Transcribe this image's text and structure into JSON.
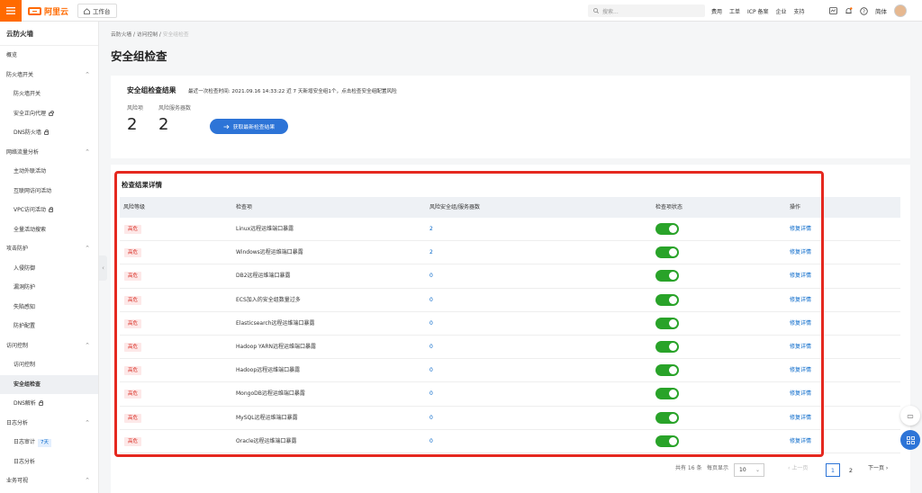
{
  "topbar": {
    "logo_text": "阿里云",
    "workbench": "工作台",
    "search_placeholder": "搜索...",
    "links": [
      "费用",
      "工单",
      "ICP 备案",
      "企业",
      "支持"
    ],
    "lang": "简体"
  },
  "sidebar": {
    "title": "云防火墙",
    "rows": [
      {
        "label": "概览",
        "kind": "group"
      },
      {
        "label": "防火墙开关",
        "kind": "group",
        "chevron": true
      },
      {
        "label": "防火墙开关",
        "kind": "item"
      },
      {
        "label": "安全正向代理",
        "kind": "item",
        "lock": true
      },
      {
        "label": "DNS防火墙",
        "kind": "item",
        "lock": true
      },
      {
        "label": "网络流量分析",
        "kind": "group",
        "chevron": true
      },
      {
        "label": "主动外联活动",
        "kind": "item"
      },
      {
        "label": "互联网访问活动",
        "kind": "item"
      },
      {
        "label": "VPC访问活动",
        "kind": "item",
        "lock": true
      },
      {
        "label": "全量活动搜索",
        "kind": "item"
      },
      {
        "label": "攻击防护",
        "kind": "group",
        "chevron": true
      },
      {
        "label": "入侵防御",
        "kind": "item"
      },
      {
        "label": "漏洞防护",
        "kind": "item"
      },
      {
        "label": "失陷感知",
        "kind": "item"
      },
      {
        "label": "防护配置",
        "kind": "item"
      },
      {
        "label": "访问控制",
        "kind": "group",
        "chevron": true
      },
      {
        "label": "访问控制",
        "kind": "item"
      },
      {
        "label": "安全组检查",
        "kind": "item",
        "active": true
      },
      {
        "label": "DNS解析",
        "kind": "item",
        "lock": true
      },
      {
        "label": "日志分析",
        "kind": "group",
        "chevron": true
      },
      {
        "label": "日志审计",
        "kind": "item",
        "badge": "7天"
      },
      {
        "label": "日志分析",
        "kind": "item"
      },
      {
        "label": "业务可视",
        "kind": "group",
        "chevron": true
      }
    ]
  },
  "breadcrumb": [
    "云防火墙",
    "访问控制",
    "安全组检查"
  ],
  "page_title": "安全组检查",
  "summary": {
    "title": "安全组检查结果",
    "subtitle": "最近一次检查时间: 2021.09.16 14:33:22  近 7 天新增安全组1个，点击检查安全组配置风险",
    "risk_items_label": "风险项",
    "risk_items_value": "2",
    "risk_servers_label": "风险服务器数",
    "risk_servers_value": "2",
    "refresh_button": "获取最新检查结果"
  },
  "details": {
    "title": "检查结果详情",
    "columns": [
      "风险等级",
      "检查项",
      "风险安全组/服务器数",
      "检查项状态",
      "操作"
    ],
    "rows": [
      {
        "level": "高危",
        "item": "Linux远程运维端口暴露",
        "count": "2",
        "enabled": true,
        "action": "修复详情"
      },
      {
        "level": "高危",
        "item": "Windows远程运维端口暴露",
        "count": "2",
        "enabled": true,
        "action": "修复详情"
      },
      {
        "level": "高危",
        "item": "DB2远程运维端口暴露",
        "count": "0",
        "enabled": true,
        "action": "修复详情"
      },
      {
        "level": "高危",
        "item": "ECS加入的安全组数量过多",
        "count": "0",
        "enabled": true,
        "action": "修复详情"
      },
      {
        "level": "高危",
        "item": "Elasticsearch远程运维端口暴露",
        "count": "0",
        "enabled": true,
        "action": "修复详情"
      },
      {
        "level": "高危",
        "item": "Hadoop YARN远程运维端口暴露",
        "count": "0",
        "enabled": true,
        "action": "修复详情"
      },
      {
        "level": "高危",
        "item": "Hadoop远程运维端口暴露",
        "count": "0",
        "enabled": true,
        "action": "修复详情"
      },
      {
        "level": "高危",
        "item": "MongoDB远程运维端口暴露",
        "count": "0",
        "enabled": true,
        "action": "修复详情"
      },
      {
        "level": "高危",
        "item": "MySQL远程运维端口暴露",
        "count": "0",
        "enabled": true,
        "action": "修复详情"
      },
      {
        "level": "高危",
        "item": "Oracle远程运维端口暴露",
        "count": "0",
        "enabled": true,
        "action": "修复详情"
      }
    ]
  },
  "pagination": {
    "total": "共有 16 条",
    "per_page_label": "每页显示",
    "per_page": "10",
    "prev": "上一页",
    "pages": [
      "1",
      "2"
    ],
    "current": "1",
    "next": "下一页"
  },
  "colors": {
    "accent": "#2d74d7",
    "brand": "#ff6a00",
    "danger": "#d93026",
    "toggle_on": "#29a329",
    "highlight": "#e5281f"
  }
}
